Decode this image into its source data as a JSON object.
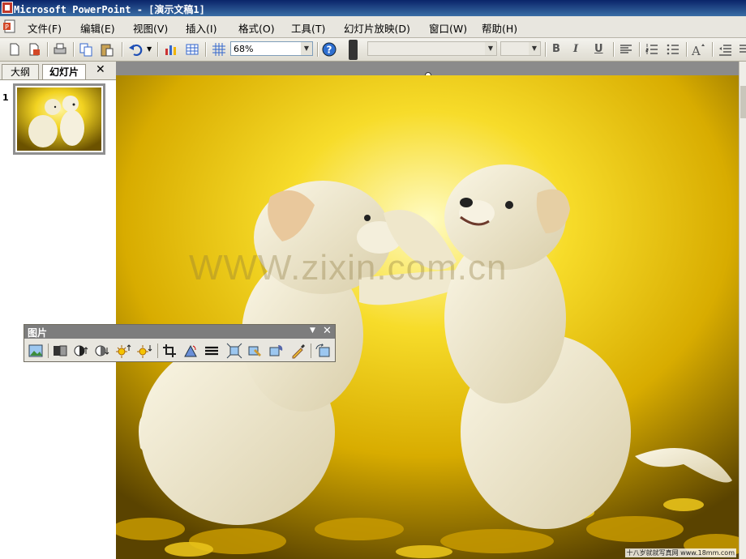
{
  "window": {
    "title": "Microsoft PowerPoint - [演示文稿1]"
  },
  "menu": {
    "items": [
      "文件(F)",
      "编辑(E)",
      "视图(V)",
      "插入(I)",
      "格式(O)",
      "工具(T)",
      "幻灯片放映(D)",
      "窗口(W)",
      "帮助(H)"
    ]
  },
  "toolbar": {
    "zoom": "68%",
    "font_name": "",
    "font_size": "",
    "bold_label": "B",
    "italic_label": "I",
    "underline_label": "U"
  },
  "panel": {
    "tabs": [
      "大纲",
      "幻灯片"
    ],
    "active_tab": "幻灯片",
    "close_label": "✕",
    "slide_number": "1"
  },
  "slide": {
    "watermark": "WWW.zixin.com.cn",
    "credit": "十八岁就就写真网 www.18mm.com"
  },
  "picture_toolbar": {
    "title": "图片",
    "dropdown_glyph": "▼",
    "close_glyph": "✕",
    "buttons": [
      "insert-picture",
      "color",
      "more-contrast",
      "less-contrast",
      "more-brightness",
      "less-brightness",
      "crop",
      "rotate-left",
      "line-style",
      "compress-pictures",
      "recolor-picture",
      "format-picture",
      "set-transparent-color",
      "reset-picture"
    ]
  },
  "colors": {
    "title_bar": "#0a246a",
    "menu_bg": "#e8e6df",
    "slide_yellow": "#f2d321",
    "work_gray": "#8b8b8b"
  }
}
